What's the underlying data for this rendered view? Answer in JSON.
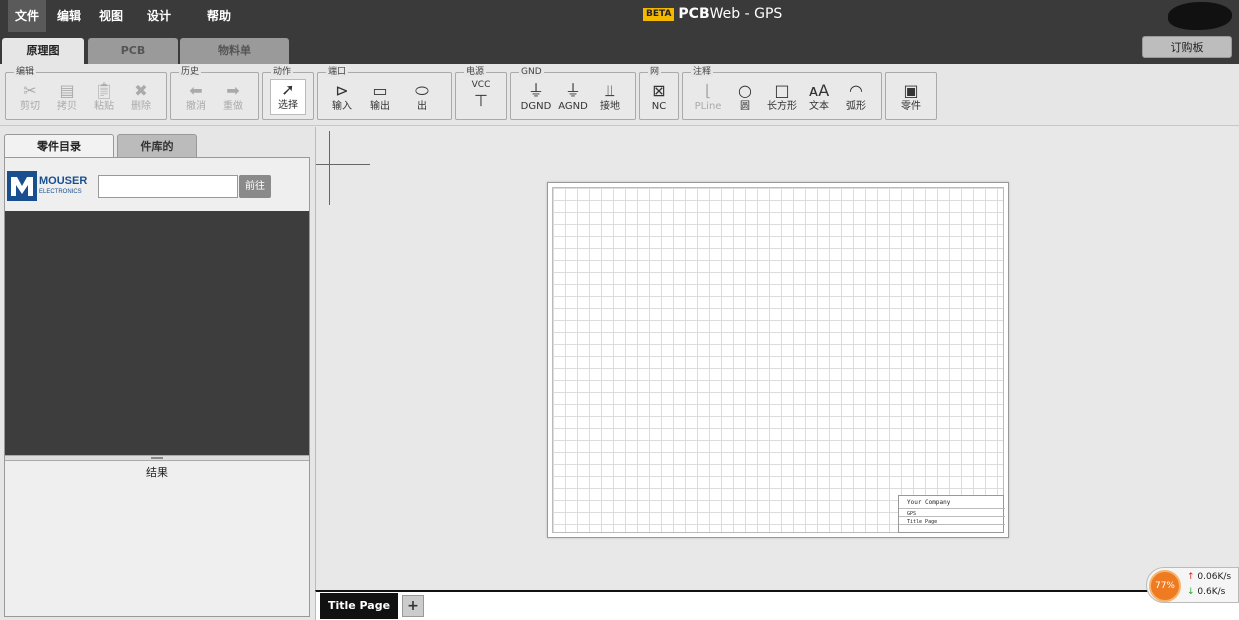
{
  "menu": {
    "items": [
      {
        "label": "文件",
        "active": true
      },
      {
        "label": "编辑"
      },
      {
        "label": "视图"
      },
      {
        "label": "设计"
      },
      {
        "label": "帮助"
      }
    ]
  },
  "app": {
    "beta": "BETA",
    "name": "PCB",
    "suffix": "Web - GPS"
  },
  "main_tabs": [
    {
      "label": "原理图",
      "active": true
    },
    {
      "label": "PCB"
    },
    {
      "label": "物料单"
    }
  ],
  "order_button": "订购板",
  "toolbar": {
    "groups": [
      {
        "title": "编辑",
        "tools": [
          {
            "label": "剪切",
            "icon": "scissors-icon",
            "disabled": true
          },
          {
            "label": "拷贝",
            "icon": "copy-icon",
            "disabled": true
          },
          {
            "label": "粘贴",
            "icon": "paste-icon",
            "disabled": true
          },
          {
            "label": "删除",
            "icon": "delete-icon",
            "disabled": true
          }
        ]
      },
      {
        "title": "历史",
        "tools": [
          {
            "label": "撤消",
            "icon": "undo-icon",
            "disabled": true
          },
          {
            "label": "重做",
            "icon": "redo-icon",
            "disabled": true
          }
        ]
      },
      {
        "title": "动作",
        "tools": [
          {
            "label": "选择",
            "icon": "cursor-icon",
            "selected": true
          }
        ]
      },
      {
        "title": "端口",
        "tools": [
          {
            "label": "输入",
            "icon": "port-input-icon"
          },
          {
            "label": "输出",
            "icon": "port-output-icon"
          },
          {
            "label": "出",
            "icon": "port-bidirectional-icon"
          }
        ]
      },
      {
        "title": "电源",
        "tools": [
          {
            "label": "VCC",
            "icon": "vcc-icon"
          }
        ]
      },
      {
        "title": "GND",
        "tools": [
          {
            "label": "DGND",
            "icon": "dgnd-icon"
          },
          {
            "label": "AGND",
            "icon": "agnd-icon"
          },
          {
            "label": "接地",
            "icon": "earth-ground-icon"
          }
        ]
      },
      {
        "title": "网",
        "tools": [
          {
            "label": "NC",
            "icon": "no-connect-icon"
          }
        ]
      },
      {
        "title": "注释",
        "tools": [
          {
            "label": "PLine",
            "icon": "pline-icon",
            "disabled": true
          },
          {
            "label": "圆",
            "icon": "circle-icon"
          },
          {
            "label": "长方形",
            "icon": "rectangle-icon"
          },
          {
            "label": "文本",
            "icon": "text-icon"
          },
          {
            "label": "弧形",
            "icon": "arc-icon"
          }
        ]
      },
      {
        "title": "",
        "tools": [
          {
            "label": "零件",
            "icon": "parts-icon"
          }
        ]
      }
    ]
  },
  "left_panel": {
    "tabs": [
      {
        "label": "零件目录",
        "active": true
      },
      {
        "label": "件库的"
      }
    ],
    "logo_line1": "MOUSER",
    "logo_line2": "ELECTRONICS",
    "search_value": "",
    "go_label": "前往",
    "results_label": "结果"
  },
  "sheet": {
    "company": "Your Company",
    "project": "GPS",
    "page": "Title Page"
  },
  "page_tabs": {
    "current": "Title Page",
    "add": "+"
  },
  "net_widget": {
    "percent": "77%",
    "up": "0.06K/s",
    "down": "0.6K/s"
  },
  "colors": {
    "topbar": "#3a3a3a",
    "beta_badge": "#f5b800",
    "net_orange": "#ee7a22"
  }
}
